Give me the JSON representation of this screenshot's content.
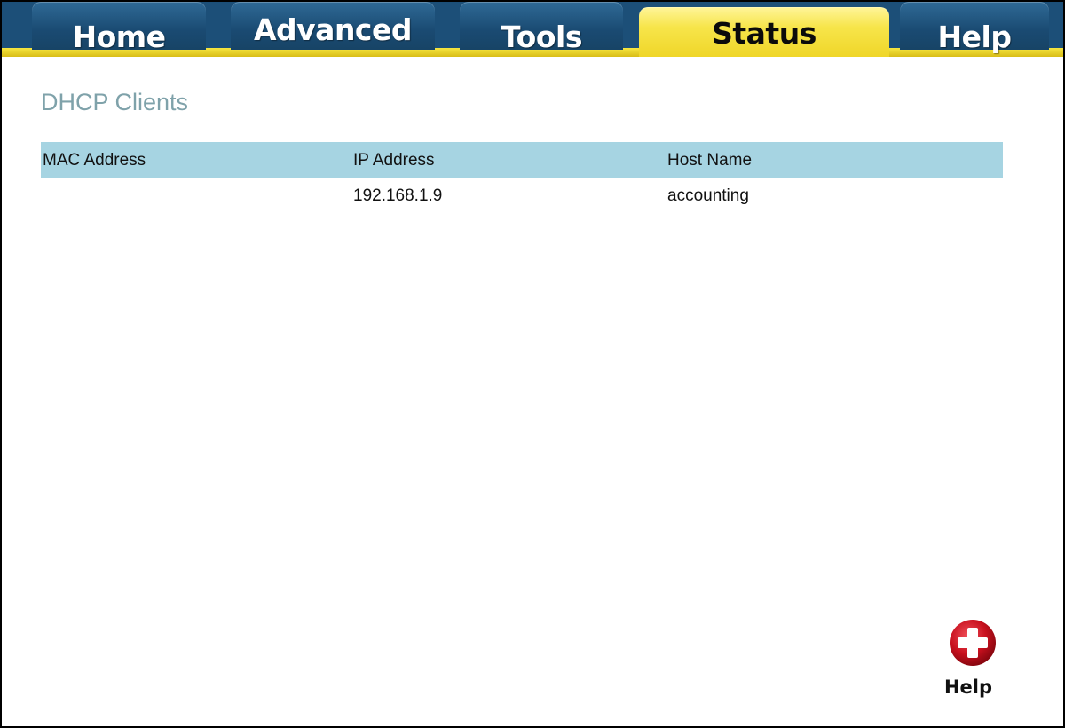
{
  "tabs": {
    "home": "Home",
    "advanced": "Advanced",
    "tools": "Tools",
    "status": "Status",
    "help": "Help",
    "active": "Status"
  },
  "colors": {
    "tab_blue": "#1c4f78",
    "tab_active_yellow": "#f7e54a",
    "title_color": "#7fa2aa",
    "table_header_bg": "#a6d4e2",
    "help_red": "#c8101e"
  },
  "page": {
    "title": "DHCP Clients"
  },
  "table": {
    "headers": {
      "mac": "MAC Address",
      "ip": "IP Address",
      "host": "Host Name"
    },
    "rows": [
      {
        "mac": "",
        "ip": "192.168.1.9",
        "host": "accounting"
      }
    ]
  },
  "help_button": {
    "icon": "plus-circle-icon",
    "label": "Help"
  }
}
